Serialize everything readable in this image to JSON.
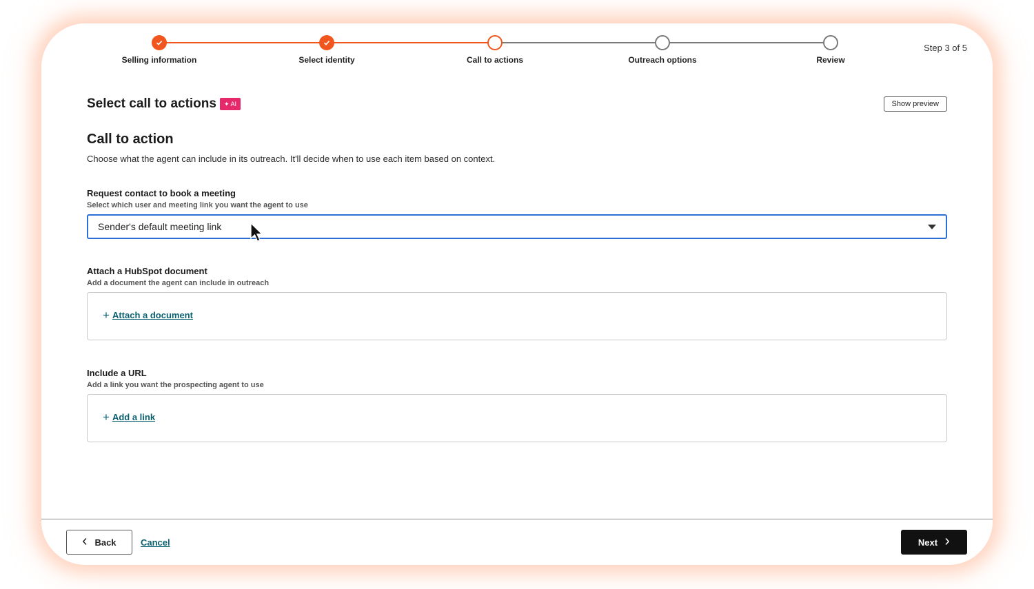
{
  "stepper": {
    "steps": [
      {
        "label": "Selling information",
        "state": "done"
      },
      {
        "label": "Select identity",
        "state": "done"
      },
      {
        "label": "Call to actions",
        "state": "current"
      },
      {
        "label": "Outreach options",
        "state": "todo"
      },
      {
        "label": "Review",
        "state": "todo"
      }
    ],
    "counter": "Step 3 of 5"
  },
  "header": {
    "title": "Select call to actions",
    "ai_badge": "AI",
    "show_preview_label": "Show preview"
  },
  "section": {
    "title": "Call to action",
    "description": "Choose what the agent can include in its outreach. It'll decide when to use each item based on context."
  },
  "meeting": {
    "label": "Request contact to book a meeting",
    "help": "Select which user and meeting link you want the agent to use",
    "selected": "Sender's default meeting link"
  },
  "document": {
    "label": "Attach a HubSpot document",
    "help": "Add a document the agent can include in outreach",
    "action": "Attach a document"
  },
  "url": {
    "label": "Include a URL",
    "help": "Add a link you want the prospecting agent to use",
    "action": "Add a link"
  },
  "footer": {
    "back_label": "Back",
    "cancel_label": "Cancel",
    "next_label": "Next"
  },
  "colors": {
    "accent": "#f0561e",
    "focus": "#2b6fd6",
    "link": "#0b6170",
    "ai_badge": "#e6296b"
  }
}
